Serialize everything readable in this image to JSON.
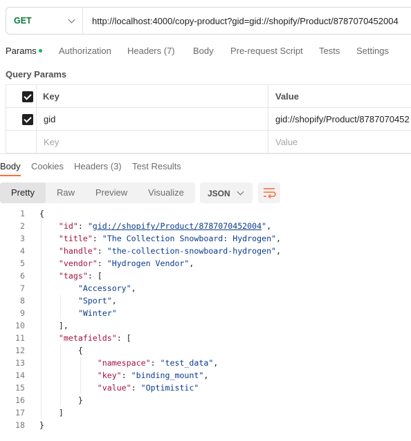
{
  "request": {
    "method": "GET",
    "url": "http://localhost:4000/copy-product?gid=gid://shopify/Product/8787070452004"
  },
  "request_tabs": [
    {
      "label": "Params",
      "active": true,
      "dot": true
    },
    {
      "label": "Authorization"
    },
    {
      "label": "Headers (7)"
    },
    {
      "label": "Body"
    },
    {
      "label": "Pre-request Script"
    },
    {
      "label": "Tests"
    },
    {
      "label": "Settings"
    }
  ],
  "query_params": {
    "title": "Query Params",
    "header": {
      "key": "Key",
      "value": "Value"
    },
    "rows": [
      {
        "key": "gid",
        "value": "gid://shopify/Product/8787070452",
        "checked": true
      }
    ],
    "placeholder": {
      "key": "Key",
      "value": "Value"
    }
  },
  "response_tabs": [
    {
      "label": "Body",
      "active": true
    },
    {
      "label": "Cookies"
    },
    {
      "label": "Headers (3)"
    },
    {
      "label": "Test Results"
    }
  ],
  "view_modes": [
    "Pretty",
    "Raw",
    "Preview",
    "Visualize"
  ],
  "active_view": "Pretty",
  "format": "JSON",
  "colors": {
    "accent": "#ff6c37",
    "get": "#0b7a3b",
    "key": "#a2123c",
    "string": "#0a3a8e",
    "dot": "#0cbb52"
  },
  "code_lines": [
    {
      "n": "1",
      "i": 0,
      "t": [
        [
          "p",
          "{"
        ]
      ]
    },
    {
      "n": "2",
      "i": 1,
      "t": [
        [
          "k",
          "\"id\""
        ],
        [
          "p",
          ": "
        ],
        [
          "s",
          "\""
        ],
        [
          "u",
          "gid://shopify/Product/8787070452004"
        ],
        [
          "s",
          "\""
        ],
        [
          "p",
          ","
        ]
      ]
    },
    {
      "n": "3",
      "i": 1,
      "t": [
        [
          "k",
          "\"title\""
        ],
        [
          "p",
          ": "
        ],
        [
          "s",
          "\"The Collection Snowboard: Hydrogen\""
        ],
        [
          "p",
          ","
        ]
      ]
    },
    {
      "n": "4",
      "i": 1,
      "t": [
        [
          "k",
          "\"handle\""
        ],
        [
          "p",
          ": "
        ],
        [
          "s",
          "\"the-collection-snowboard-hydrogen\""
        ],
        [
          "p",
          ","
        ]
      ]
    },
    {
      "n": "5",
      "i": 1,
      "t": [
        [
          "k",
          "\"vendor\""
        ],
        [
          "p",
          ": "
        ],
        [
          "s",
          "\"Hydrogen Vendor\""
        ],
        [
          "p",
          ","
        ]
      ]
    },
    {
      "n": "6",
      "i": 1,
      "t": [
        [
          "k",
          "\"tags\""
        ],
        [
          "p",
          ": ["
        ]
      ]
    },
    {
      "n": "7",
      "i": 2,
      "t": [
        [
          "s",
          "\"Accessory\""
        ],
        [
          "p",
          ","
        ]
      ]
    },
    {
      "n": "8",
      "i": 2,
      "t": [
        [
          "s",
          "\"Sport\""
        ],
        [
          "p",
          ","
        ]
      ]
    },
    {
      "n": "9",
      "i": 2,
      "t": [
        [
          "s",
          "\"Winter\""
        ]
      ]
    },
    {
      "n": "10",
      "i": 1,
      "t": [
        [
          "p",
          "],"
        ]
      ]
    },
    {
      "n": "11",
      "i": 1,
      "t": [
        [
          "k",
          "\"metafields\""
        ],
        [
          "p",
          ": ["
        ]
      ]
    },
    {
      "n": "12",
      "i": 2,
      "t": [
        [
          "p",
          "{"
        ]
      ]
    },
    {
      "n": "13",
      "i": 3,
      "t": [
        [
          "k",
          "\"namespace\""
        ],
        [
          "p",
          ": "
        ],
        [
          "s",
          "\"test_data\""
        ],
        [
          "p",
          ","
        ]
      ]
    },
    {
      "n": "14",
      "i": 3,
      "t": [
        [
          "k",
          "\"key\""
        ],
        [
          "p",
          ": "
        ],
        [
          "s",
          "\"binding_mount\""
        ],
        [
          "p",
          ","
        ]
      ]
    },
    {
      "n": "15",
      "i": 3,
      "t": [
        [
          "k",
          "\"value\""
        ],
        [
          "p",
          ": "
        ],
        [
          "s",
          "\"Optimistic\""
        ]
      ]
    },
    {
      "n": "16",
      "i": 2,
      "t": [
        [
          "p",
          "}"
        ]
      ]
    },
    {
      "n": "17",
      "i": 1,
      "t": [
        [
          "p",
          "]"
        ]
      ]
    },
    {
      "n": "18",
      "i": 0,
      "t": [
        [
          "p",
          "}"
        ]
      ]
    }
  ]
}
